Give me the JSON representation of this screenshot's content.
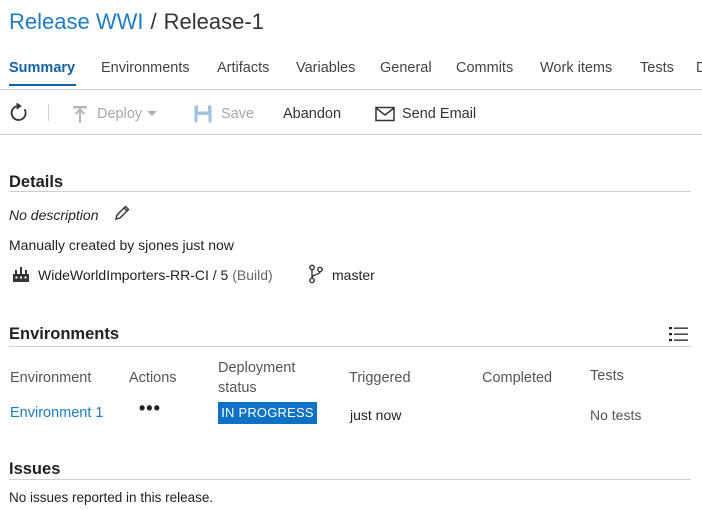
{
  "breadcrumb": {
    "parent": "Release WWI",
    "separator": "/",
    "current": "Release-1"
  },
  "tabs": [
    {
      "label": "Summary",
      "active": true
    },
    {
      "label": "Environments"
    },
    {
      "label": "Artifacts"
    },
    {
      "label": "Variables"
    },
    {
      "label": "General"
    },
    {
      "label": "Commits"
    },
    {
      "label": "Work items"
    },
    {
      "label": "Tests"
    },
    {
      "label": "D"
    }
  ],
  "toolbar": {
    "refresh_icon": "refresh-icon",
    "deploy_label": "Deploy",
    "save_label": "Save",
    "abandon_label": "Abandon",
    "send_email_label": "Send Email"
  },
  "details": {
    "heading": "Details",
    "description": "No description",
    "created": "Manually created by sjones just now",
    "artifact_name": "WideWorldImporters-RR-CI / 5",
    "artifact_type": "(Build)",
    "branch": "master"
  },
  "environments": {
    "heading": "Environments",
    "columns": {
      "environment": "Environment",
      "actions": "Actions",
      "deployment_status_1": "Deployment",
      "deployment_status_2": "status",
      "triggered": "Triggered",
      "completed": "Completed",
      "tests": "Tests"
    },
    "rows": [
      {
        "environment": "Environment 1",
        "actions": "•••",
        "status": "IN PROGRESS",
        "triggered": "just now",
        "completed": "",
        "tests": "No tests"
      }
    ]
  },
  "issues": {
    "heading": "Issues",
    "message": "No issues reported in this release."
  },
  "colors": {
    "accent": "#1e7cc4",
    "active_tab": "#1464a5",
    "badge": "#0f72c5"
  }
}
